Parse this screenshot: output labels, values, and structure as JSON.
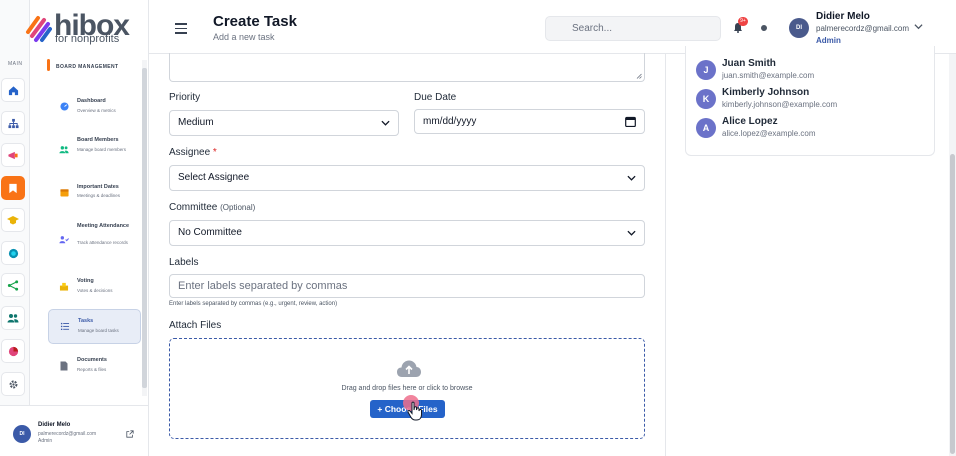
{
  "brand": {
    "name": "hibox",
    "tagline": "for nonprofits"
  },
  "rail": {
    "label": "MAIN"
  },
  "sidebar": {
    "section": "BOARD MANAGEMENT",
    "items": [
      {
        "title": "Dashboard",
        "sub": "Overview & metrics"
      },
      {
        "title": "Board Members",
        "sub": "Manage board members"
      },
      {
        "title": "Important Dates",
        "sub": "Meetings & deadlines"
      },
      {
        "title": "Meeting Attendance",
        "sub": "Track attendance records"
      },
      {
        "title": "Voting",
        "sub": "Votes & decisions"
      },
      {
        "title": "Tasks",
        "sub": "Manage board tasks"
      },
      {
        "title": "Documents",
        "sub": "Reports & files"
      }
    ],
    "user": {
      "initials": "DI",
      "name": "Didier Melo",
      "email": "palmerecordz@gmail.com",
      "role": "Admin"
    }
  },
  "header": {
    "title": "Create Task",
    "subtitle": "Add a new task",
    "search_placeholder": "Search...",
    "notif_count": "9+",
    "user": {
      "initials": "DI",
      "name": "Didier Melo",
      "email": "palmerecordz@gmail.com",
      "role": "Admin"
    }
  },
  "form": {
    "priority_label": "Priority",
    "priority_value": "Medium",
    "due_label": "Due Date",
    "due_placeholder": "mm/dd/yyyy",
    "assignee_label": "Assignee",
    "assignee_required": "*",
    "assignee_value": "Select Assignee",
    "committee_label": "Committee",
    "committee_optional": "(Optional)",
    "committee_value": "No Committee",
    "labels_label": "Labels",
    "labels_placeholder": "Enter labels separated by commas",
    "labels_hint": "Enter labels separated by commas (e.g., urgent, review, action)",
    "attach_label": "Attach Files",
    "drop_text": "Drag and drop files here or click to browse",
    "choose_label": "+ Choose Files"
  },
  "members": [
    {
      "initial": "J",
      "name": "Juan Smith",
      "email": "juan.smith@example.com"
    },
    {
      "initial": "K",
      "name": "Kimberly Johnson",
      "email": "kimberly.johnson@example.com"
    },
    {
      "initial": "A",
      "name": "Alice Lopez",
      "email": "alice.lopez@example.com"
    }
  ],
  "colors": {
    "accent": "#2563c9",
    "brand_orange": "#f97316",
    "required": "#dc2626"
  }
}
